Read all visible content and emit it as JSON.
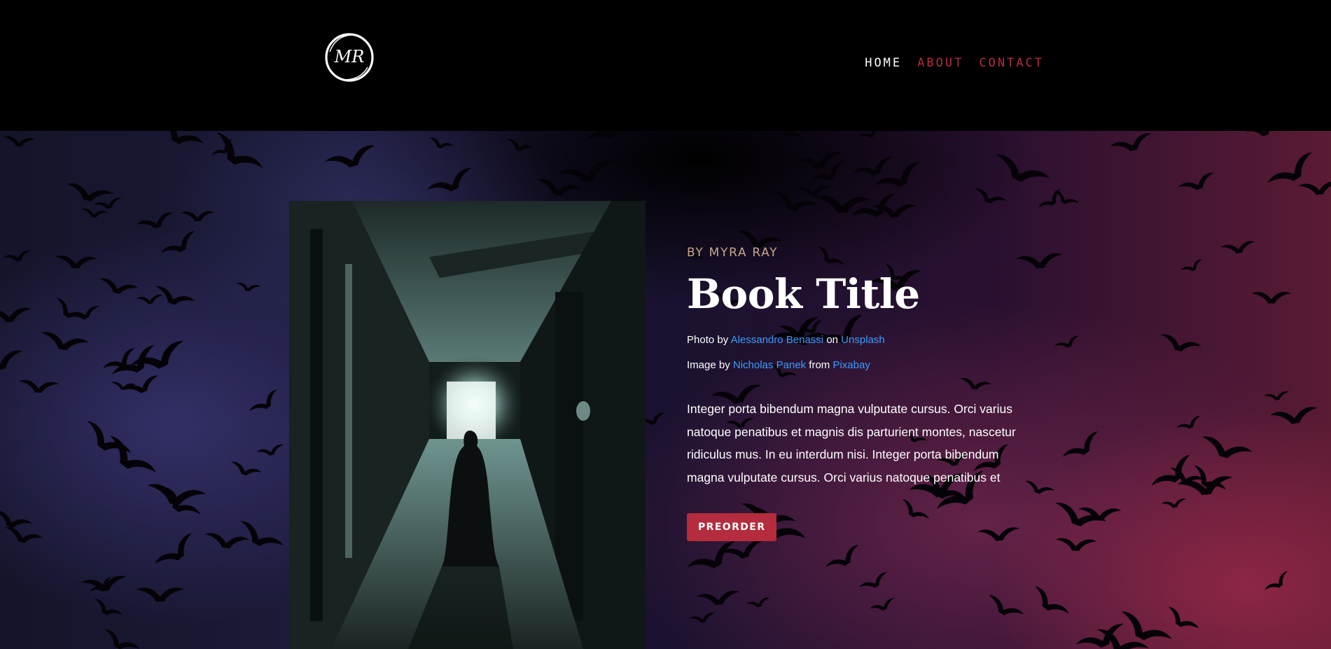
{
  "header": {
    "logo_text": "MR",
    "nav": [
      {
        "label": "HOME",
        "active": true
      },
      {
        "label": "ABOUT",
        "active": false
      },
      {
        "label": "CONTACT",
        "active": false
      }
    ]
  },
  "hero": {
    "byline": "BY MYRA RAY",
    "title": "Book Title",
    "photo_credit": {
      "prefix": "Photo by",
      "author": "Alessandro Benassi",
      "middle": "on",
      "source": "Unsplash"
    },
    "image_credit": {
      "prefix": "Image by",
      "author": "Nicholas Panek",
      "middle": "from",
      "source": "Pixabay"
    },
    "description": "Integer porta bibendum magna vulputate cursus. Orci varius natoque penatibus et magnis dis parturient montes, nascetur ridiculus mus. In eu interdum nisi. Integer porta bibendum magna vulputate cursus. Orci varius natoque penatibus et",
    "button_label": "PREORDER"
  },
  "colors": {
    "accent": "#b42c3d",
    "link": "#3b9cff",
    "byline": "#c8a68f",
    "background": "#000000"
  }
}
